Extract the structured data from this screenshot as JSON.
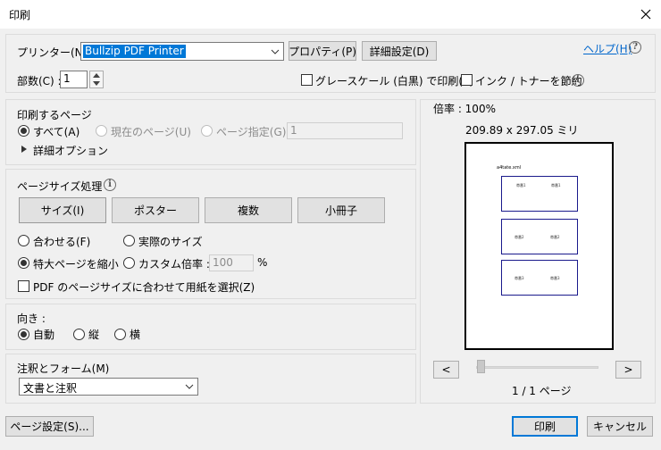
{
  "window": {
    "title": "印刷"
  },
  "printer": {
    "label": "プリンター(N) :",
    "selected": "Bullzip PDF Printer",
    "properties_btn": "プロパティ(P)",
    "advanced_btn": "詳細設定(D)",
    "help_link": "ヘルプ(H)",
    "copies_label": "部数(C) :",
    "copies_value": "1",
    "grayscale_label": "グレースケール (白黒) で印刷(Y)",
    "save_ink_label": "インク / トナーを節約"
  },
  "pages": {
    "heading": "印刷するページ",
    "all": "すべて(A)",
    "current": "現在のページ(U)",
    "range": "ページ指定(G)",
    "range_value": "1",
    "more_options": "詳細オプション"
  },
  "page_sizing": {
    "heading": "ページサイズ処理",
    "tabs": [
      "サイズ(I)",
      "ポスター",
      "複数",
      "小冊子"
    ],
    "fit": "合わせる(F)",
    "actual": "実際のサイズ",
    "shrink": "特大ページを縮小",
    "custom": "カスタム倍率 :",
    "custom_value": "100",
    "percent": "%",
    "choose_paper": "PDF のページサイズに合わせて用紙を選択(Z)"
  },
  "orientation": {
    "heading": "向き :",
    "auto": "自動",
    "portrait": "縦",
    "landscape": "横"
  },
  "comments": {
    "heading": "注釈とフォーム(M)",
    "selected": "文書と注釈"
  },
  "preview": {
    "scale": "倍率 : 100%",
    "dimensions": "209.89 x 297.05 ミリ",
    "doc_title": "a4tate.xml",
    "cells": [
      "帯番1",
      "帯番1",
      "帯番2",
      "帯番2",
      "帯番3",
      "帯番3"
    ],
    "prev": "<",
    "next": ">",
    "page_indicator": "1 / 1 ページ"
  },
  "footer": {
    "page_setup": "ページ設定(S)...",
    "print": "印刷",
    "cancel": "キャンセル"
  }
}
